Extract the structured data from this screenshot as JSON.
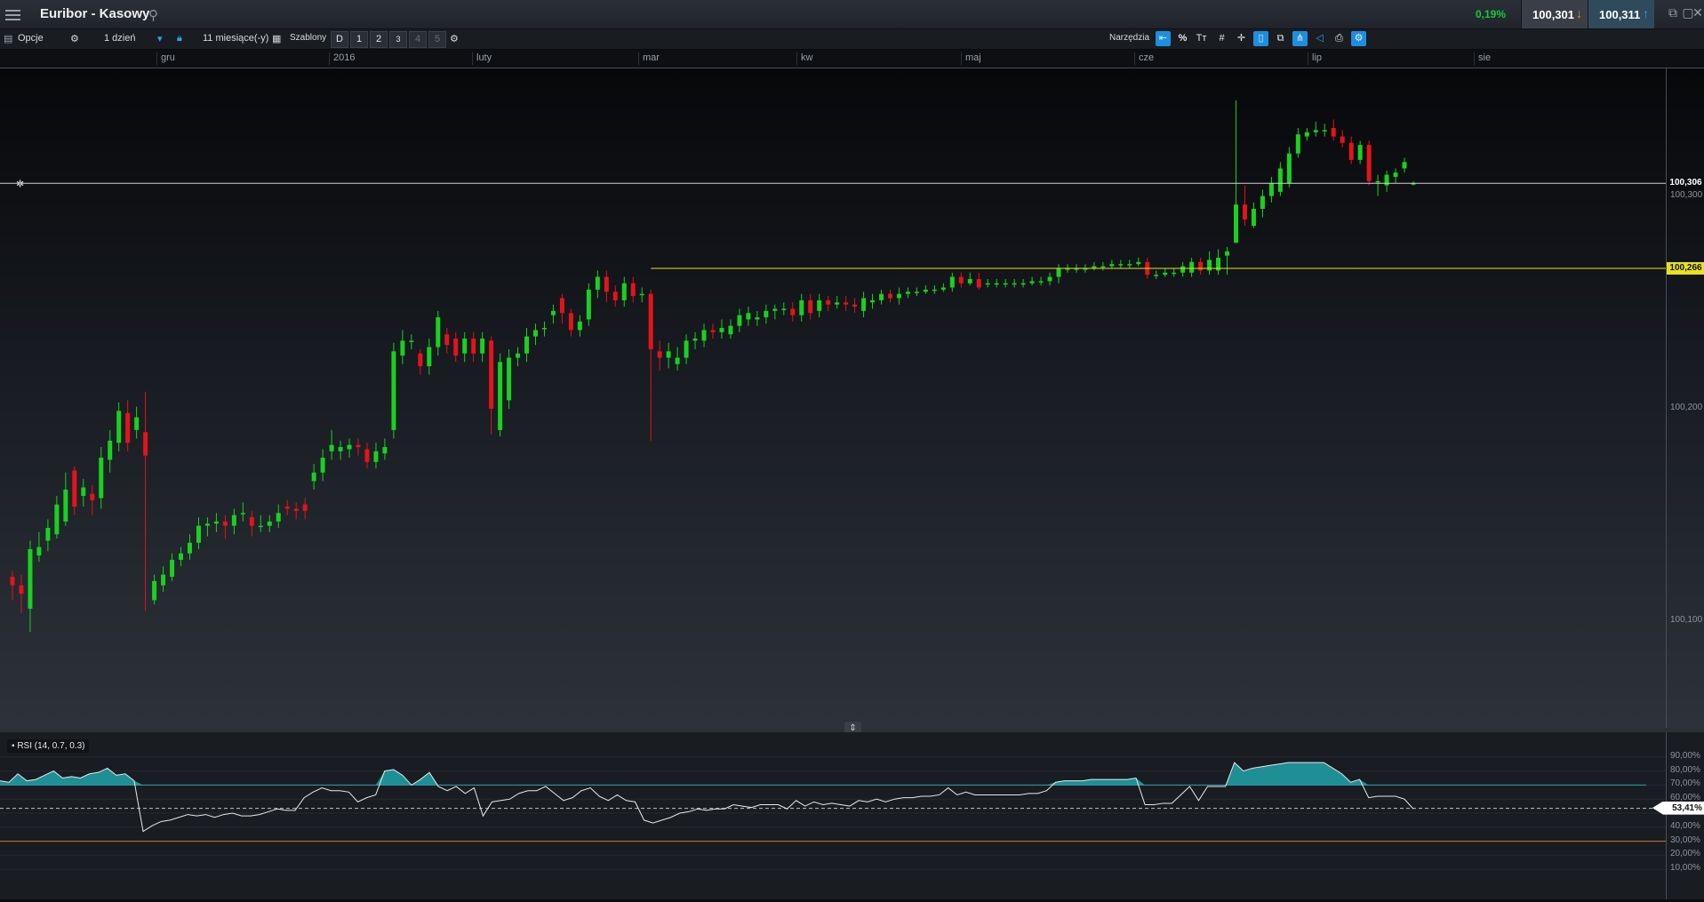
{
  "titlebar": {
    "title": "Euribor - Kasowy",
    "change": "0,19%",
    "bid": "100,301",
    "ask": "100,311"
  },
  "toolbar": {
    "options_label": "Opcje",
    "interval": "1 dzień",
    "range": "11 miesiące(-y)",
    "templates_label": "Szablony",
    "template_buttons": [
      "D",
      "1",
      "2",
      "3",
      "4",
      "5"
    ],
    "tools_label": "Narzędzia",
    "percent_label": "%"
  },
  "timeline": {
    "months": [
      "gru",
      "2016",
      "luty",
      "mar",
      "kw",
      "maj",
      "cze",
      "lip",
      "sie"
    ]
  },
  "price_axis": {
    "ticks": [
      "100,300",
      "100,200",
      "100,100"
    ],
    "current_label": "100,306",
    "level_label": "100,266"
  },
  "rsi": {
    "label": "RSI (14, 0.7, 0.3)",
    "ticks": [
      "90,00%",
      "80,00%",
      "70,00%",
      "60,00%",
      "50,00%",
      "40,00%",
      "30,00%",
      "20,00%",
      "10,00%"
    ],
    "current_label": "53,41%",
    "upper": 0.7,
    "lower": 0.3
  },
  "colors": {
    "up": "#19d11f",
    "down": "#e3141a",
    "level": "#e8e21a",
    "rsi_fill": "#1f8f96",
    "rsi_upper": "#2aa6ad",
    "rsi_lower": "#c87b2a"
  },
  "chart_data": {
    "type": "candlestick",
    "y_label_precision": 3,
    "ylim": [
      100.05,
      100.36
    ],
    "candles": [
      {
        "o": 100.121,
        "c": 100.117,
        "h": 100.124,
        "l": 100.11
      },
      {
        "o": 100.117,
        "c": 100.113,
        "h": 100.122,
        "l": 100.104
      },
      {
        "o": 100.106,
        "c": 100.134,
        "h": 100.138,
        "l": 100.095
      },
      {
        "o": 100.131,
        "c": 100.135,
        "h": 100.142,
        "l": 100.128
      },
      {
        "o": 100.138,
        "c": 100.144,
        "h": 100.148,
        "l": 100.133
      },
      {
        "o": 100.141,
        "c": 100.155,
        "h": 100.159,
        "l": 100.139
      },
      {
        "o": 100.147,
        "c": 100.162,
        "h": 100.17,
        "l": 100.145
      },
      {
        "o": 100.171,
        "c": 100.154,
        "h": 100.173,
        "l": 100.15
      },
      {
        "o": 100.159,
        "c": 100.163,
        "h": 100.167,
        "l": 100.154
      },
      {
        "o": 100.16,
        "c": 100.157,
        "h": 100.164,
        "l": 100.15
      },
      {
        "o": 100.158,
        "c": 100.177,
        "h": 100.182,
        "l": 100.153
      },
      {
        "o": 100.176,
        "c": 100.185,
        "h": 100.19,
        "l": 100.17
      },
      {
        "o": 100.184,
        "c": 100.199,
        "h": 100.203,
        "l": 100.18
      },
      {
        "o": 100.198,
        "c": 100.184,
        "h": 100.204,
        "l": 100.18
      },
      {
        "o": 100.19,
        "c": 100.196,
        "h": 100.201,
        "l": 100.186
      },
      {
        "o": 100.189,
        "c": 100.178,
        "h": 100.208,
        "l": 100.105
      },
      {
        "o": 100.11,
        "c": 100.119,
        "h": 100.122,
        "l": 100.108
      },
      {
        "o": 100.117,
        "c": 100.122,
        "h": 100.126,
        "l": 100.114
      },
      {
        "o": 100.121,
        "c": 100.129,
        "h": 100.132,
        "l": 100.119
      },
      {
        "o": 100.129,
        "c": 100.132,
        "h": 100.135,
        "l": 100.126
      },
      {
        "o": 100.132,
        "c": 100.137,
        "h": 100.141,
        "l": 100.129
      },
      {
        "o": 100.137,
        "c": 100.145,
        "h": 100.149,
        "l": 100.134
      },
      {
        "o": 100.145,
        "c": 100.146,
        "h": 100.149,
        "l": 100.14
      },
      {
        "o": 100.146,
        "c": 100.147,
        "h": 100.151,
        "l": 100.142
      },
      {
        "o": 100.147,
        "c": 100.145,
        "h": 100.15,
        "l": 100.139
      },
      {
        "o": 100.145,
        "c": 100.15,
        "h": 100.153,
        "l": 100.141
      },
      {
        "o": 100.151,
        "c": 100.151,
        "h": 100.156,
        "l": 100.147
      },
      {
        "o": 100.149,
        "c": 100.145,
        "h": 100.152,
        "l": 100.14
      },
      {
        "o": 100.145,
        "c": 100.145,
        "h": 100.15,
        "l": 100.142
      },
      {
        "o": 100.145,
        "c": 100.147,
        "h": 100.15,
        "l": 100.142
      },
      {
        "o": 100.147,
        "c": 100.151,
        "h": 100.155,
        "l": 100.144
      },
      {
        "o": 100.154,
        "c": 100.153,
        "h": 100.157,
        "l": 100.15
      },
      {
        "o": 100.153,
        "c": 100.152,
        "h": 100.156,
        "l": 100.148
      },
      {
        "o": 100.155,
        "c": 100.152,
        "h": 100.158,
        "l": 100.148
      },
      {
        "o": 100.166,
        "c": 100.17,
        "h": 100.174,
        "l": 100.162
      },
      {
        "o": 100.17,
        "c": 100.177,
        "h": 100.181,
        "l": 100.166
      },
      {
        "o": 100.18,
        "c": 100.183,
        "h": 100.19,
        "l": 100.176
      },
      {
        "o": 100.18,
        "c": 100.182,
        "h": 100.185,
        "l": 100.176
      },
      {
        "o": 100.181,
        "c": 100.183,
        "h": 100.186,
        "l": 100.177
      },
      {
        "o": 100.183,
        "c": 100.182,
        "h": 100.186,
        "l": 100.178
      },
      {
        "o": 100.181,
        "c": 100.175,
        "h": 100.184,
        "l": 100.172
      },
      {
        "o": 100.175,
        "c": 100.18,
        "h": 100.184,
        "l": 100.172
      },
      {
        "o": 100.179,
        "c": 100.182,
        "h": 100.186,
        "l": 100.176
      },
      {
        "o": 100.19,
        "c": 100.227,
        "h": 100.231,
        "l": 100.186
      },
      {
        "o": 100.225,
        "c": 100.232,
        "h": 100.237,
        "l": 100.221
      },
      {
        "o": 100.232,
        "c": 100.232,
        "h": 100.235,
        "l": 100.228
      },
      {
        "o": 100.226,
        "c": 100.22,
        "h": 100.228,
        "l": 100.216
      },
      {
        "o": 100.22,
        "c": 100.229,
        "h": 100.233,
        "l": 100.216
      },
      {
        "o": 100.229,
        "c": 100.243,
        "h": 100.246,
        "l": 100.225
      },
      {
        "o": 100.235,
        "c": 100.23,
        "h": 100.238,
        "l": 100.226
      },
      {
        "o": 100.233,
        "c": 100.225,
        "h": 100.236,
        "l": 100.222
      },
      {
        "o": 100.226,
        "c": 100.233,
        "h": 100.236,
        "l": 100.222
      },
      {
        "o": 100.233,
        "c": 100.226,
        "h": 100.236,
        "l": 100.222
      },
      {
        "o": 100.226,
        "c": 100.233,
        "h": 100.236,
        "l": 100.222
      },
      {
        "o": 100.232,
        "c": 100.2,
        "h": 100.234,
        "l": 100.188
      },
      {
        "o": 100.19,
        "c": 100.222,
        "h": 100.226,
        "l": 100.187
      },
      {
        "o": 100.204,
        "c": 100.224,
        "h": 100.228,
        "l": 100.2
      },
      {
        "o": 100.224,
        "c": 100.226,
        "h": 100.229,
        "l": 100.22
      },
      {
        "o": 100.226,
        "c": 100.234,
        "h": 100.238,
        "l": 100.222
      },
      {
        "o": 100.234,
        "c": 100.237,
        "h": 100.24,
        "l": 100.23
      },
      {
        "o": 100.238,
        "c": 100.238,
        "h": 100.241,
        "l": 100.234
      },
      {
        "o": 100.244,
        "c": 100.246,
        "h": 100.249,
        "l": 100.24
      },
      {
        "o": 100.252,
        "c": 100.245,
        "h": 100.254,
        "l": 100.24
      },
      {
        "o": 100.245,
        "c": 100.237,
        "h": 100.247,
        "l": 100.234
      },
      {
        "o": 100.237,
        "c": 100.241,
        "h": 100.244,
        "l": 100.234
      },
      {
        "o": 100.242,
        "c": 100.256,
        "h": 100.259,
        "l": 100.239
      },
      {
        "o": 100.256,
        "c": 100.262,
        "h": 100.265,
        "l": 100.252
      },
      {
        "o": 100.262,
        "c": 100.255,
        "h": 100.265,
        "l": 100.25
      },
      {
        "o": 100.255,
        "c": 100.251,
        "h": 100.258,
        "l": 100.248
      },
      {
        "o": 100.251,
        "c": 100.259,
        "h": 100.262,
        "l": 100.248
      },
      {
        "o": 100.259,
        "c": 100.253,
        "h": 100.262,
        "l": 100.25
      },
      {
        "o": 100.254,
        "c": 100.254,
        "h": 100.257,
        "l": 100.25
      },
      {
        "o": 100.254,
        "c": 100.228,
        "h": 100.256,
        "l": 100.185
      },
      {
        "o": 100.227,
        "c": 100.224,
        "h": 100.232,
        "l": 100.218
      },
      {
        "o": 100.224,
        "c": 100.227,
        "h": 100.231,
        "l": 100.219
      },
      {
        "o": 100.221,
        "c": 100.224,
        "h": 100.229,
        "l": 100.218
      },
      {
        "o": 100.224,
        "c": 100.232,
        "h": 100.235,
        "l": 100.221
      },
      {
        "o": 100.232,
        "c": 100.233,
        "h": 100.236,
        "l": 100.228
      },
      {
        "o": 100.232,
        "c": 100.237,
        "h": 100.24,
        "l": 100.229
      },
      {
        "o": 100.237,
        "c": 100.236,
        "h": 100.24,
        "l": 100.233
      },
      {
        "o": 100.236,
        "c": 100.238,
        "h": 100.242,
        "l": 100.233
      },
      {
        "o": 100.235,
        "c": 100.239,
        "h": 100.242,
        "l": 100.233
      },
      {
        "o": 100.239,
        "c": 100.244,
        "h": 100.247,
        "l": 100.236
      },
      {
        "o": 100.242,
        "c": 100.245,
        "h": 100.248,
        "l": 100.239
      },
      {
        "o": 100.242,
        "c": 100.243,
        "h": 100.246,
        "l": 100.239
      },
      {
        "o": 100.243,
        "c": 100.246,
        "h": 100.249,
        "l": 100.24
      },
      {
        "o": 100.246,
        "c": 100.247,
        "h": 100.249,
        "l": 100.242
      },
      {
        "o": 100.247,
        "c": 100.247,
        "h": 100.25,
        "l": 100.244
      },
      {
        "o": 100.247,
        "c": 100.244,
        "h": 100.25,
        "l": 100.241
      },
      {
        "o": 100.244,
        "c": 100.251,
        "h": 100.254,
        "l": 100.241
      },
      {
        "o": 100.251,
        "c": 100.245,
        "h": 100.254,
        "l": 100.242
      },
      {
        "o": 100.246,
        "c": 100.251,
        "h": 100.254,
        "l": 100.243
      },
      {
        "o": 100.251,
        "c": 100.249,
        "h": 100.253,
        "l": 100.246
      },
      {
        "o": 100.249,
        "c": 100.25,
        "h": 100.253,
        "l": 100.247
      },
      {
        "o": 100.25,
        "c": 100.249,
        "h": 100.253,
        "l": 100.246
      },
      {
        "o": 100.249,
        "c": 100.248,
        "h": 100.252,
        "l": 100.245
      },
      {
        "o": 100.246,
        "c": 100.252,
        "h": 100.255,
        "l": 100.243
      },
      {
        "o": 100.25,
        "c": 100.251,
        "h": 100.254,
        "l": 100.247
      },
      {
        "o": 100.251,
        "c": 100.254,
        "h": 100.256,
        "l": 100.249
      },
      {
        "o": 100.254,
        "c": 100.252,
        "h": 100.256,
        "l": 100.25
      },
      {
        "o": 100.252,
        "c": 100.254,
        "h": 100.257,
        "l": 100.249
      },
      {
        "o": 100.254,
        "c": 100.255,
        "h": 100.257,
        "l": 100.252
      },
      {
        "o": 100.255,
        "c": 100.255,
        "h": 100.257,
        "l": 100.253
      },
      {
        "o": 100.255,
        "c": 100.256,
        "h": 100.258,
        "l": 100.254
      },
      {
        "o": 100.256,
        "c": 100.256,
        "h": 100.258,
        "l": 100.254
      },
      {
        "o": 100.256,
        "c": 100.257,
        "h": 100.259,
        "l": 100.255
      },
      {
        "o": 100.257,
        "c": 100.262,
        "h": 100.264,
        "l": 100.255
      },
      {
        "o": 100.262,
        "c": 100.259,
        "h": 100.264,
        "l": 100.257
      },
      {
        "o": 100.259,
        "c": 100.261,
        "h": 100.264,
        "l": 100.258
      },
      {
        "o": 100.261,
        "c": 100.257,
        "h": 100.264,
        "l": 100.256
      },
      {
        "o": 100.259,
        "c": 100.259,
        "h": 100.261,
        "l": 100.257
      },
      {
        "o": 100.259,
        "c": 100.259,
        "h": 100.261,
        "l": 100.257
      },
      {
        "o": 100.259,
        "c": 100.259,
        "h": 100.261,
        "l": 100.257
      },
      {
        "o": 100.259,
        "c": 100.259,
        "h": 100.261,
        "l": 100.257
      },
      {
        "o": 100.259,
        "c": 100.259,
        "h": 100.261,
        "l": 100.257
      },
      {
        "o": 100.259,
        "c": 100.26,
        "h": 100.262,
        "l": 100.258
      },
      {
        "o": 100.26,
        "c": 100.26,
        "h": 100.262,
        "l": 100.258
      },
      {
        "o": 100.26,
        "c": 100.262,
        "h": 100.264,
        "l": 100.258
      },
      {
        "o": 100.262,
        "c": 100.266,
        "h": 100.268,
        "l": 100.259
      },
      {
        "o": 100.266,
        "c": 100.266,
        "h": 100.268,
        "l": 100.264
      },
      {
        "o": 100.266,
        "c": 100.266,
        "h": 100.268,
        "l": 100.264
      },
      {
        "o": 100.266,
        "c": 100.266,
        "h": 100.268,
        "l": 100.264
      },
      {
        "o": 100.266,
        "c": 100.267,
        "h": 100.269,
        "l": 100.265
      },
      {
        "o": 100.267,
        "c": 100.267,
        "h": 100.269,
        "l": 100.265
      },
      {
        "o": 100.267,
        "c": 100.268,
        "h": 100.27,
        "l": 100.266
      },
      {
        "o": 100.268,
        "c": 100.268,
        "h": 100.27,
        "l": 100.266
      },
      {
        "o": 100.268,
        "c": 100.268,
        "h": 100.27,
        "l": 100.266
      },
      {
        "o": 100.268,
        "c": 100.269,
        "h": 100.271,
        "l": 100.267
      },
      {
        "o": 100.269,
        "c": 100.263,
        "h": 100.271,
        "l": 100.261
      },
      {
        "o": 100.263,
        "c": 100.263,
        "h": 100.265,
        "l": 100.261
      },
      {
        "o": 100.263,
        "c": 100.264,
        "h": 100.266,
        "l": 100.262
      },
      {
        "o": 100.264,
        "c": 100.264,
        "h": 100.266,
        "l": 100.262
      },
      {
        "o": 100.264,
        "c": 100.267,
        "h": 100.269,
        "l": 100.262
      },
      {
        "o": 100.264,
        "c": 100.269,
        "h": 100.271,
        "l": 100.262
      },
      {
        "o": 100.269,
        "c": 100.265,
        "h": 100.271,
        "l": 100.263
      },
      {
        "o": 100.265,
        "c": 100.27,
        "h": 100.274,
        "l": 100.263
      },
      {
        "o": 100.265,
        "c": 100.271,
        "h": 100.275,
        "l": 100.263
      },
      {
        "o": 100.272,
        "c": 100.274,
        "h": 100.276,
        "l": 100.263
      },
      {
        "o": 100.278,
        "c": 100.296,
        "h": 100.345,
        "l": 100.283
      },
      {
        "o": 100.296,
        "c": 100.289,
        "h": 100.305,
        "l": 100.286
      },
      {
        "o": 100.286,
        "c": 100.294,
        "h": 100.297,
        "l": 100.285
      },
      {
        "o": 100.294,
        "c": 100.3,
        "h": 100.303,
        "l": 100.29
      },
      {
        "o": 100.3,
        "c": 100.306,
        "h": 100.309,
        "l": 100.297
      },
      {
        "o": 100.302,
        "c": 100.313,
        "h": 100.316,
        "l": 100.3
      },
      {
        "o": 100.306,
        "c": 100.32,
        "h": 100.323,
        "l": 100.304
      },
      {
        "o": 100.32,
        "c": 100.329,
        "h": 100.332,
        "l": 100.318
      },
      {
        "o": 100.328,
        "c": 100.33,
        "h": 100.332,
        "l": 100.326
      },
      {
        "o": 100.33,
        "c": 100.331,
        "h": 100.335,
        "l": 100.328
      },
      {
        "o": 100.331,
        "c": 100.331,
        "h": 100.334,
        "l": 100.328
      },
      {
        "o": 100.332,
        "c": 100.328,
        "h": 100.336,
        "l": 100.326
      },
      {
        "o": 100.328,
        "c": 100.325,
        "h": 100.331,
        "l": 100.323
      },
      {
        "o": 100.325,
        "c": 100.317,
        "h": 100.328,
        "l": 100.315
      },
      {
        "o": 100.317,
        "c": 100.324,
        "h": 100.326,
        "l": 100.315
      },
      {
        "o": 100.324,
        "c": 100.307,
        "h": 100.326,
        "l": 100.305
      },
      {
        "o": 100.307,
        "c": 100.307,
        "h": 100.31,
        "l": 100.3
      },
      {
        "o": 100.305,
        "c": 100.31,
        "h": 100.312,
        "l": 100.302
      },
      {
        "o": 100.309,
        "c": 100.311,
        "h": 100.313,
        "l": 100.306
      },
      {
        "o": 100.313,
        "c": 100.316,
        "h": 100.318,
        "l": 100.311
      },
      {
        "o": 100.306,
        "c": 100.306,
        "h": 100.307,
        "l": 100.305
      }
    ],
    "rsi": [
      0.73,
      0.72,
      0.78,
      0.73,
      0.74,
      0.77,
      0.8,
      0.75,
      0.76,
      0.75,
      0.78,
      0.79,
      0.82,
      0.77,
      0.78,
      0.73,
      0.37,
      0.41,
      0.44,
      0.45,
      0.47,
      0.49,
      0.48,
      0.49,
      0.47,
      0.49,
      0.5,
      0.48,
      0.48,
      0.49,
      0.51,
      0.53,
      0.52,
      0.52,
      0.61,
      0.65,
      0.68,
      0.66,
      0.66,
      0.65,
      0.58,
      0.61,
      0.63,
      0.8,
      0.81,
      0.77,
      0.7,
      0.74,
      0.79,
      0.69,
      0.66,
      0.69,
      0.64,
      0.68,
      0.48,
      0.58,
      0.59,
      0.6,
      0.64,
      0.66,
      0.66,
      0.69,
      0.64,
      0.59,
      0.61,
      0.66,
      0.68,
      0.62,
      0.59,
      0.63,
      0.59,
      0.58,
      0.45,
      0.43,
      0.45,
      0.47,
      0.5,
      0.51,
      0.53,
      0.52,
      0.53,
      0.53,
      0.56,
      0.55,
      0.54,
      0.56,
      0.56,
      0.56,
      0.53,
      0.59,
      0.55,
      0.58,
      0.56,
      0.57,
      0.56,
      0.55,
      0.59,
      0.58,
      0.6,
      0.58,
      0.6,
      0.61,
      0.61,
      0.62,
      0.62,
      0.63,
      0.68,
      0.63,
      0.65,
      0.63,
      0.63,
      0.63,
      0.63,
      0.63,
      0.63,
      0.64,
      0.64,
      0.66,
      0.72,
      0.73,
      0.73,
      0.73,
      0.74,
      0.74,
      0.74,
      0.74,
      0.74,
      0.75,
      0.56,
      0.56,
      0.57,
      0.57,
      0.63,
      0.69,
      0.59,
      0.69,
      0.69,
      0.69,
      0.86,
      0.8,
      0.82,
      0.83,
      0.84,
      0.85,
      0.86,
      0.86,
      0.86,
      0.86,
      0.86,
      0.82,
      0.78,
      0.72,
      0.74,
      0.61,
      0.62,
      0.62,
      0.62,
      0.6,
      0.53
    ]
  }
}
